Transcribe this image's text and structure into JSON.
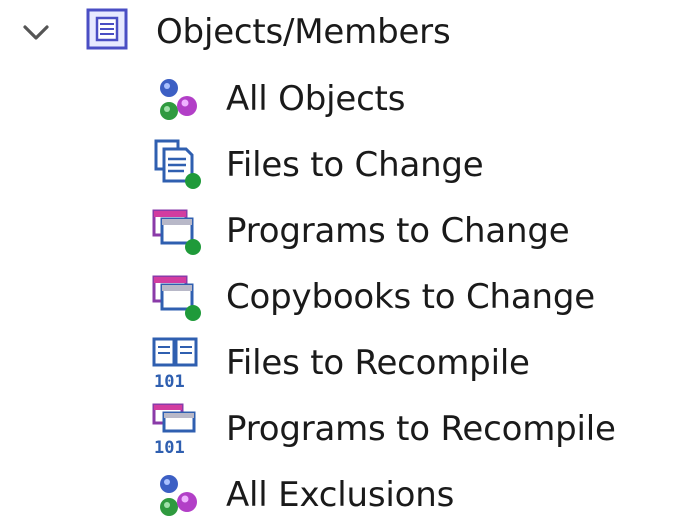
{
  "tree": {
    "parent": {
      "label": "Objects/Members",
      "expanded": true,
      "icon": "objects-members-icon"
    },
    "children": [
      {
        "label": "All Objects",
        "icon": "objects-icon"
      },
      {
        "label": "Files to Change",
        "icon": "files-change-icon"
      },
      {
        "label": "Programs to Change",
        "icon": "programs-change-icon"
      },
      {
        "label": "Copybooks to Change",
        "icon": "copybooks-change-icon"
      },
      {
        "label": "Files to Recompile",
        "icon": "files-recompile-icon"
      },
      {
        "label": "Programs to Recompile",
        "icon": "programs-recompile-icon"
      },
      {
        "label": "All Exclusions",
        "icon": "exclusions-icon"
      }
    ]
  },
  "colors": {
    "blue": "#2f5fb0",
    "purple": "#a64ac9",
    "green": "#1f9a3a",
    "pinkbar": "#d23ca0",
    "text": "#1a1a1a"
  }
}
